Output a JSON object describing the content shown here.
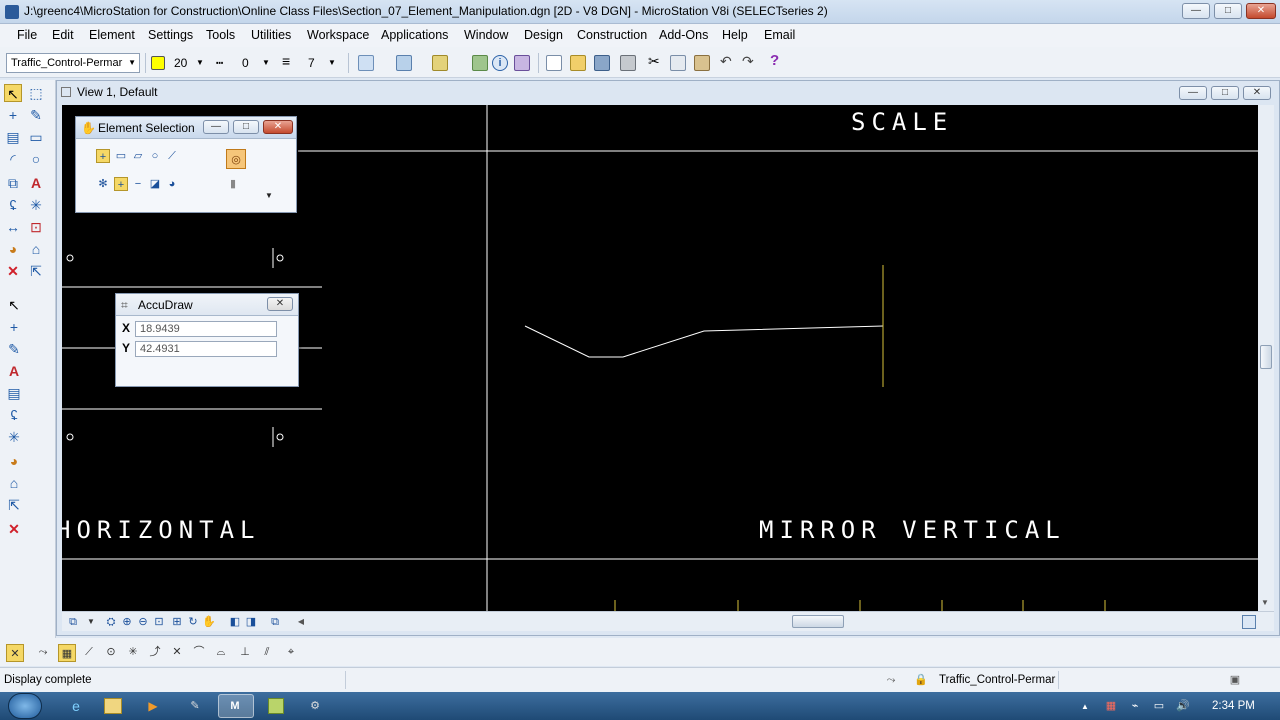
{
  "window": {
    "title": "J:\\greenc4\\MicroStation for Construction\\Online Class Files\\Section_07_Element_Manipulation.dgn [2D - V8 DGN] - MicroStation V8i (SELECTseries 2)",
    "minimize": "—",
    "maximize": "□",
    "close": "✕"
  },
  "menu": [
    "File",
    "Edit",
    "Element",
    "Settings",
    "Tools",
    "Utilities",
    "Workspace",
    "Applications",
    "Window",
    "Design",
    "Construction",
    "Add-Ons",
    "Help",
    "Email"
  ],
  "attributes": {
    "level": "Traffic_Control-Permar",
    "color_value": "20",
    "color_swatch": "#ffff00",
    "style_value": "0",
    "weight_value": "7"
  },
  "view": {
    "title": "View 1, Default",
    "labels": {
      "scale": "SCALE",
      "horizontal": "HORIZONTAL",
      "mirror_vertical": "MIRROR VERTICAL"
    }
  },
  "element_selection": {
    "title": "Element Selection"
  },
  "accudraw": {
    "title": "AccuDraw",
    "x_label": "X",
    "y_label": "Y",
    "x_value": "18.9439",
    "y_value": "42.4931"
  },
  "status": {
    "message": "Display complete",
    "active_level": "Traffic_Control-Permar"
  },
  "taskbar": {
    "time": "2:34 PM"
  }
}
